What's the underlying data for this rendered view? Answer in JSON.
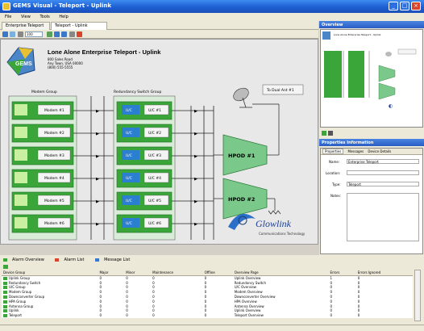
{
  "window": {
    "title": "GEMS Visual - Teleport - Uplink",
    "min": "_",
    "max": "□",
    "close": "×"
  },
  "menu": [
    "File",
    "View",
    "Tools",
    "Help"
  ],
  "doc_tabs": [
    "Enterprise Teleport",
    "Teleport - Uplink"
  ],
  "toolbar": {
    "zoom": "100"
  },
  "canvas": {
    "heading": "Lone Alone Enterprise Teleport - Uplink",
    "address": [
      "800 Sales Road",
      "Any Town, USA 00000",
      "(800) 555-5555"
    ],
    "modem_group_label": "Modem Group",
    "switch_group_label": "Redundancy Switch Group",
    "modems": [
      "Modem #1",
      "Modem #2",
      "Modem #3",
      "Modem #4",
      "Modem #5",
      "Modem #6"
    ],
    "udcs": [
      "U/C #1",
      "U/C #2",
      "U/C #3",
      "U/C #4",
      "U/C #5",
      "U/C #6"
    ],
    "udc_tag": "U/C",
    "hpa1": "HPOD #1",
    "hpa2": "HPOD #2",
    "antenna_label": "To Dual Ant #1",
    "logo": "Glowlink",
    "logo_tag": "Communications Technology"
  },
  "right_pane": {
    "overview_title": "Overview",
    "overview_caption": "Lone Alone Enterprise Teleport - Uplink",
    "props_title": "Properties Information",
    "props_tabs": [
      "Properties",
      "Messages",
      "Device Details"
    ],
    "props": [
      {
        "label": "Name:",
        "value": "Enterprise Teleport"
      },
      {
        "label": "Location:",
        "value": ""
      },
      {
        "label": "Type:",
        "value": "Teleport"
      },
      {
        "label": "Notes:",
        "value": ""
      }
    ]
  },
  "bottom": {
    "tabs": [
      "Alarm Overview",
      "Alarm List",
      "Message List"
    ],
    "columns": [
      "Device Group",
      "Major",
      "Minor",
      "Maintenance",
      "Offline",
      "Overview Page",
      "Errors",
      "Errors Ignored"
    ],
    "rows": [
      [
        "Uplink Group",
        "0",
        "0",
        "0",
        "0",
        "Uplink Overview",
        "1",
        "0"
      ],
      [
        "Redundancy Switch",
        "0",
        "0",
        "0",
        "0",
        "Redundancy Switch",
        "0",
        "0"
      ],
      [
        "U/C Group",
        "0",
        "0",
        "0",
        "0",
        "U/C Overview",
        "0",
        "0"
      ],
      [
        "Modem Group",
        "0",
        "0",
        "0",
        "0",
        "Modem Overview",
        "0",
        "0"
      ],
      [
        "Downconverter Group",
        "0",
        "0",
        "0",
        "0",
        "Downconverter Overview",
        "0",
        "0"
      ],
      [
        "HPA Group",
        "0",
        "0",
        "0",
        "0",
        "HPA Overview",
        "0",
        "0"
      ],
      [
        "Antenna Group",
        "0",
        "0",
        "0",
        "0",
        "Antenna Overview",
        "0",
        "0"
      ],
      [
        "Uplink",
        "0",
        "0",
        "0",
        "0",
        "Uplink Overview",
        "0",
        "0"
      ],
      [
        "Teleport",
        "0",
        "0",
        "0",
        "0",
        "Teleport Overview",
        "0",
        "0"
      ]
    ]
  },
  "colors": {
    "accent": "#2a5cc4",
    "device_green": "#3aa63a",
    "hpa_green": "#7ac98a"
  }
}
